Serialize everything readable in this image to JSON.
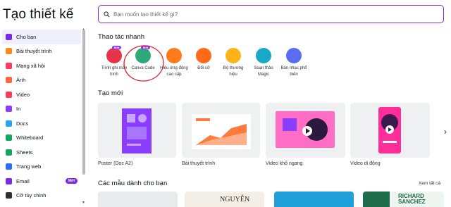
{
  "app": {
    "title": "Tạo thiết kế"
  },
  "sidebar": {
    "items": [
      {
        "label": "Cho bạn",
        "icon": "sparkle-icon",
        "color": "#7d2ae8"
      },
      {
        "label": "Bài thuyết trình",
        "icon": "presentation-icon",
        "color": "#ff8a1a"
      },
      {
        "label": "Mạng xã hội",
        "icon": "heart-icon",
        "color": "#ff3b5c"
      },
      {
        "label": "Ảnh",
        "icon": "photo-icon",
        "color": "#ff6a3d"
      },
      {
        "label": "Video",
        "icon": "video-icon",
        "color": "#ff3b5c"
      },
      {
        "label": "In",
        "icon": "printer-icon",
        "color": "#8b3dff"
      },
      {
        "label": "Docs",
        "icon": "docs-icon",
        "color": "#2aa3ff"
      },
      {
        "label": "Whiteboard",
        "icon": "whiteboard-icon",
        "color": "#13a65e"
      },
      {
        "label": "Sheets",
        "icon": "sheets-icon",
        "color": "#13a65e"
      },
      {
        "label": "Trang web",
        "icon": "website-icon",
        "color": "#2a6ff7"
      },
      {
        "label": "Email",
        "icon": "email-icon",
        "color": "#7d2ae8",
        "badge": "Mới"
      },
      {
        "label": "Cỡ tùy chỉnh",
        "icon": "resize-icon",
        "color": "#2d3034"
      }
    ]
  },
  "search": {
    "placeholder": "Bạn muốn tạo thiết kế gì?"
  },
  "quick_actions": {
    "heading": "Thao tác nhanh",
    "items": [
      {
        "label": "Trình ghi màn hình",
        "color": "#e8344a",
        "badge": "Mới"
      },
      {
        "label": "Canva Code",
        "color": "#2fa97a",
        "badge": "Mới"
      },
      {
        "label": "Hiệu ứng động cao cấp",
        "color": "#ff7a1a"
      },
      {
        "label": "Đổi cỡ",
        "color": "#ff6a1a"
      },
      {
        "label": "Bộ thương hiệu",
        "color": "#ffb21a"
      },
      {
        "label": "Soạn thảo Magic",
        "color": "#1aa8c8"
      },
      {
        "label": "Bản nhạc phổ biến",
        "color": "#5a6cf0"
      }
    ]
  },
  "create_new": {
    "heading": "Tạo mới",
    "items": [
      {
        "label": "Poster (Dọc A2)"
      },
      {
        "label": "Bài thuyết trình"
      },
      {
        "label": "Video khổ ngang"
      },
      {
        "label": "Video di động"
      }
    ]
  },
  "recommended": {
    "heading": "Các mẫu dành cho bạn",
    "see_all": "Xem tất cả",
    "snippets": [
      "NGUYỄN",
      "RICHARD",
      "SANCHEZ"
    ]
  }
}
